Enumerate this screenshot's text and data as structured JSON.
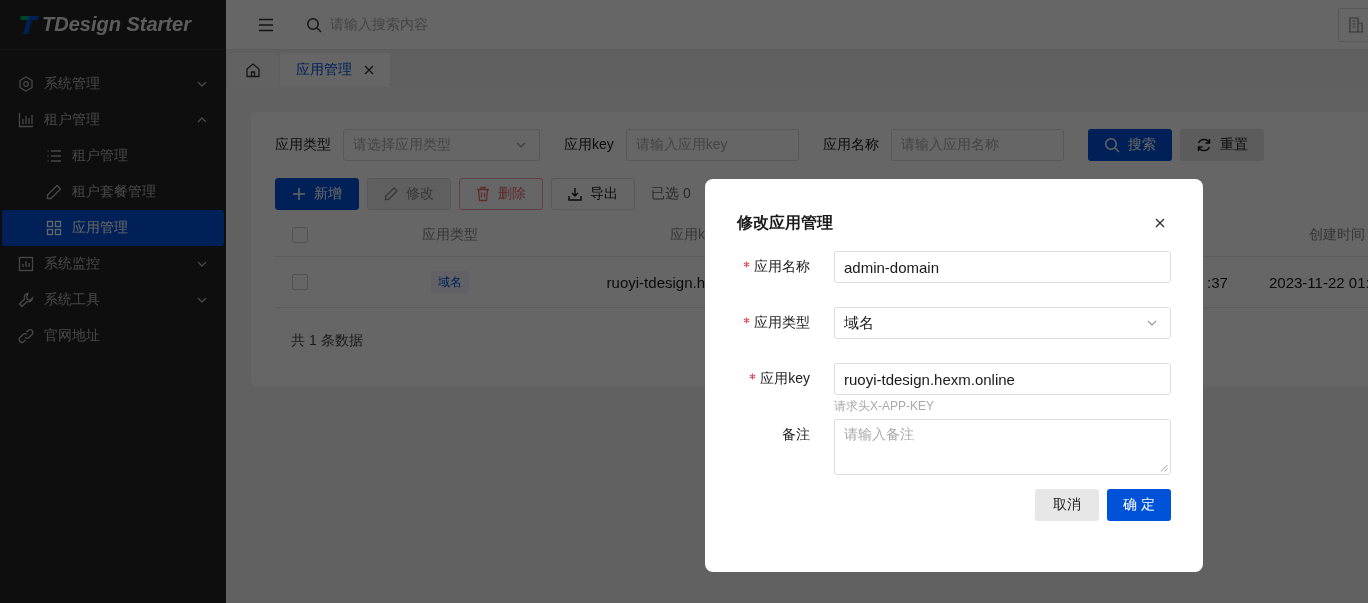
{
  "sidebar": {
    "logo": "TDesign Starter",
    "items": [
      {
        "label": "系统管理",
        "kind": "submenu",
        "expanded": false,
        "selected": false
      },
      {
        "label": "租户管理",
        "kind": "submenu",
        "expanded": true,
        "selected": false,
        "children": [
          {
            "label": "租户管理",
            "selected": false
          },
          {
            "label": "租户套餐管理",
            "selected": false
          },
          {
            "label": "应用管理",
            "selected": true
          }
        ]
      },
      {
        "label": "系统监控",
        "kind": "submenu",
        "expanded": false,
        "selected": false
      },
      {
        "label": "系统工具",
        "kind": "submenu",
        "expanded": false,
        "selected": false
      },
      {
        "label": "官网地址",
        "kind": "link",
        "selected": false
      }
    ]
  },
  "header": {
    "search_placeholder": "请输入搜索内容"
  },
  "tabs": [
    {
      "kind": "home",
      "selected": false
    },
    {
      "kind": "page",
      "label": "应用管理",
      "selected": true
    }
  ],
  "filters": [
    {
      "label": "应用类型",
      "kind": "select",
      "placeholder": "请选择应用类型"
    },
    {
      "label": "应用key",
      "kind": "input",
      "placeholder": "请输入应用key"
    },
    {
      "label": "应用名称",
      "kind": "input",
      "placeholder": "请输入应用名称"
    }
  ],
  "filter_buttons": [
    {
      "label": "搜索",
      "kind": "primary"
    },
    {
      "label": "重置",
      "kind": "secondary"
    }
  ],
  "toolbar": {
    "buttons": [
      {
        "label": "新增",
        "kind": "add",
        "disabled": false
      },
      {
        "label": "修改",
        "kind": "edit",
        "disabled": true
      },
      {
        "label": "删除",
        "kind": "delete",
        "disabled": true
      },
      {
        "label": "导出",
        "kind": "export",
        "disabled": false
      }
    ],
    "selection_text": "已选 0"
  },
  "table": {
    "header_checked": false,
    "columns": [
      "应用类型",
      "应用k",
      "创建时间"
    ],
    "rows": [
      {
        "checked": false,
        "type_tag": "域名",
        "column_3": "ruoyi-tdesign.h",
        "column_4": ":37",
        "column_5": "2023-11-22 01:"
      }
    ],
    "footer": "共 1 条数据"
  },
  "dialog": {
    "title": "修改应用管理",
    "fields": [
      {
        "label": "应用名称",
        "required": true,
        "kind": "input",
        "value": "admin-domain"
      },
      {
        "label": "应用类型",
        "required": true,
        "kind": "select",
        "value": "域名"
      },
      {
        "label": "应用key",
        "required": true,
        "kind": "input",
        "value": "ruoyi-tdesign.hexm.online",
        "help": "请求头X-APP-KEY"
      },
      {
        "label": "备注",
        "required": false,
        "kind": "textarea",
        "placeholder": "请输入备注"
      }
    ],
    "buttons": [
      {
        "label": "取消",
        "kind": "secondary"
      },
      {
        "label": "确 定",
        "kind": "primary"
      }
    ]
  }
}
